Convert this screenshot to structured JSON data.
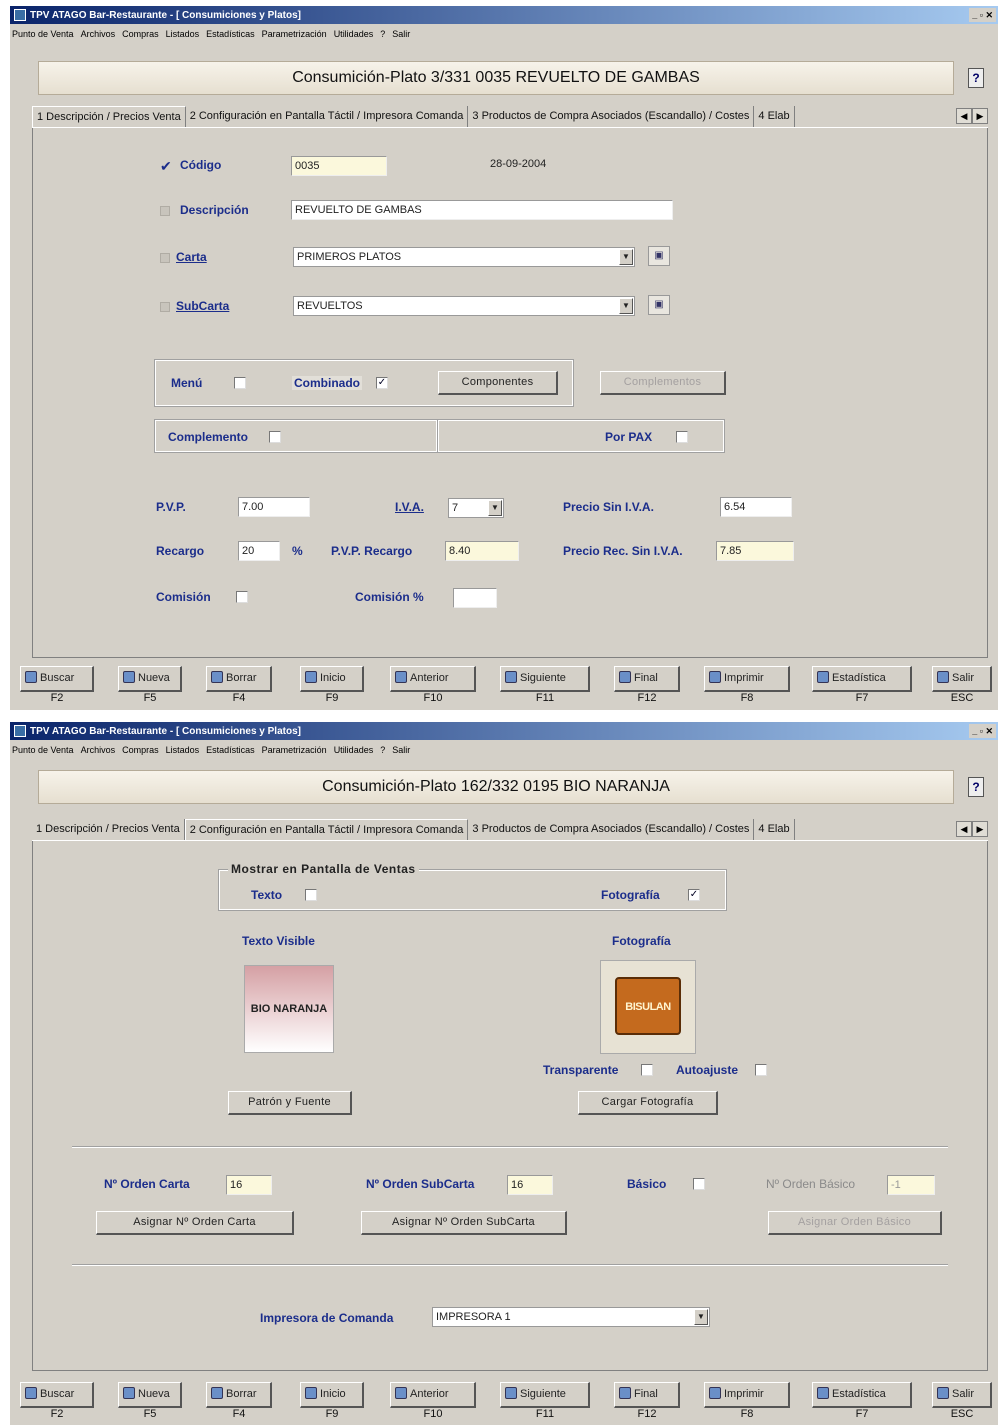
{
  "app_title": "TPV ATAGO Bar-Restaurante - [ Consumiciones y Platos]",
  "window_controls": "_|&#|X",
  "menu": [
    "Punto de Venta",
    "Archivos",
    "Compras",
    "Listados",
    "Estadísticas",
    "Parametrización",
    "Utilidades",
    "?",
    "Salir"
  ],
  "tabs": [
    "1 Descripción / Precios Venta",
    "2 Configuración en Pantalla Táctil / Impresora Comanda",
    "3 Productos de Compra Asociados (Escandallo) / Costes",
    "4 Elab"
  ],
  "screen1": {
    "header": "Consumición-Plato 3/331  0035  REVUELTO DE GAMBAS",
    "codigo_label": "Código",
    "codigo_value": "0035",
    "fecha": "28-09-2004",
    "descripcion_label": "Descripción",
    "descripcion_value": "REVUELTO DE GAMBAS",
    "carta_label": "Carta",
    "carta_value": "PRIMEROS PLATOS",
    "subcarta_label": "SubCarta",
    "subcarta_value": "REVUELTOS",
    "menu_label": "Menú",
    "combinado_label": "Combinado",
    "componentes_button": "Componentes",
    "complementos_button": "Complementos",
    "complemento_label": "Complemento",
    "porpax_label": "Por PAX",
    "pvp_label": "P.V.P.",
    "pvp_value": "7.00",
    "iva_label": "I.V.A.",
    "iva_value": "7",
    "precio_sin_iva_label": "Precio Sin I.V.A.",
    "precio_sin_iva_value": "6.54",
    "recargo_label": "Recargo",
    "recargo_value": "20",
    "percent": "%",
    "pvp_recargo_label": "P.V.P. Recargo",
    "pvp_recargo_value": "8.40",
    "precio_rec_label": "Precio Rec. Sin I.V.A.",
    "precio_rec_value": "7.85",
    "comision_label": "Comisión",
    "comision_pct_label": "Comisión %",
    "comision_pct_value": ""
  },
  "screen2": {
    "header": "Consumición-Plato 162/332  0195  BIO NARANJA",
    "mostrar_title": "Mostrar en Pantalla de Ventas",
    "texto_label": "Texto",
    "fotografia_label": "Fotografía",
    "texto_visible_label": "Texto Visible",
    "fotografia_title": "Fotografía",
    "thumb_text": "BIO NARANJA",
    "logo_text": "BISULAN",
    "transparente_label": "Transparente",
    "autoajuste_label": "Autoajuste",
    "patron_button": "Patrón y Fuente",
    "cargar_button": "Cargar Fotografía",
    "orden_carta_label": "Nº Orden Carta",
    "orden_carta_value": "16",
    "orden_subcarta_label": "Nº Orden SubCarta",
    "orden_subcarta_value": "16",
    "basico_label": "Básico",
    "orden_basico_label": "Nº Orden Básico",
    "orden_basico_value": "-1",
    "asignar_carta_button": "Asignar Nº Orden Carta",
    "asignar_subcarta_button": "Asignar Nº Orden SubCarta",
    "asignar_basico_button": "Asignar Orden Básico",
    "impresora_label": "Impresora de Comanda",
    "impresora_value": "IMPRESORA 1"
  },
  "footer": [
    {
      "label": "Buscar",
      "key": "F2"
    },
    {
      "label": "Nueva",
      "key": "F5"
    },
    {
      "label": "Borrar",
      "key": "F4"
    },
    {
      "label": "Inicio",
      "key": "F9"
    },
    {
      "label": "Anterior",
      "key": "F10"
    },
    {
      "label": "Siguiente",
      "key": "F11"
    },
    {
      "label": "Final",
      "key": "F12"
    },
    {
      "label": "Imprimir",
      "key": "F8"
    },
    {
      "label": "Estadística",
      "key": "F7"
    },
    {
      "label": "Salir",
      "key": "ESC"
    }
  ]
}
